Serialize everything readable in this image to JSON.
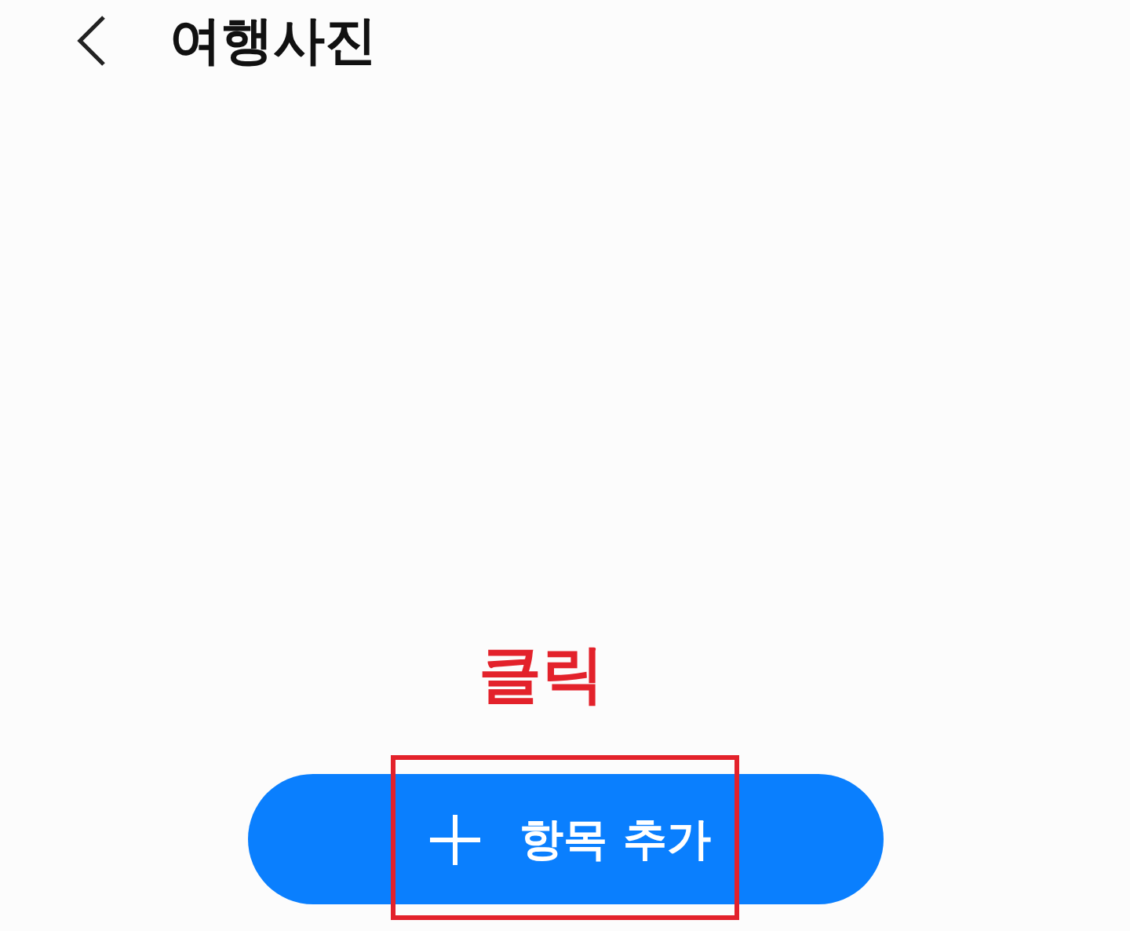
{
  "header": {
    "title": "여행사진"
  },
  "annotation": {
    "label": "클릭"
  },
  "button": {
    "label": "항목 추가"
  }
}
